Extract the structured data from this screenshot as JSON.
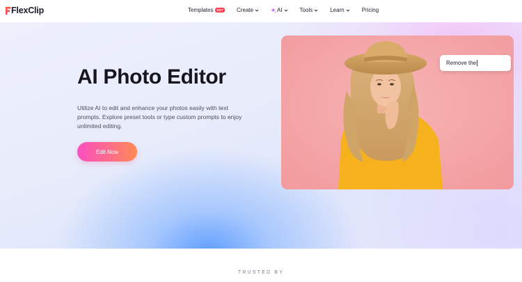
{
  "header": {
    "logo_text": "FlexClip",
    "logo_icon": "flexclip-logo-icon",
    "nav": [
      {
        "label": "Templates",
        "badge": "HOT",
        "has_chevron": false
      },
      {
        "label": "Create",
        "has_chevron": true
      },
      {
        "label": "AI",
        "icon": "sparkle-icon",
        "has_chevron": true
      },
      {
        "label": "Tools",
        "has_chevron": true
      },
      {
        "label": "Learn",
        "has_chevron": true
      },
      {
        "label": "Pricing",
        "has_chevron": false
      }
    ]
  },
  "hero": {
    "title": "AI Photo Editor",
    "description": "Utilize AI to edit and enhance your photos easily with text prompts. Explore preset tools or type custom prompts to enjoy unlimited editing.",
    "cta_label": "Edit Now",
    "prompt_value": "Remove the",
    "image_alt": "woman-with-straw-hat-photo"
  },
  "trusted": {
    "label": "TRUSTED BY"
  },
  "colors": {
    "cta_gradient_start": "#fb4fc0",
    "cta_gradient_end": "#ff8a52",
    "photo_background": "#f4a7a9",
    "hot_badge": "#ff3b4e"
  }
}
